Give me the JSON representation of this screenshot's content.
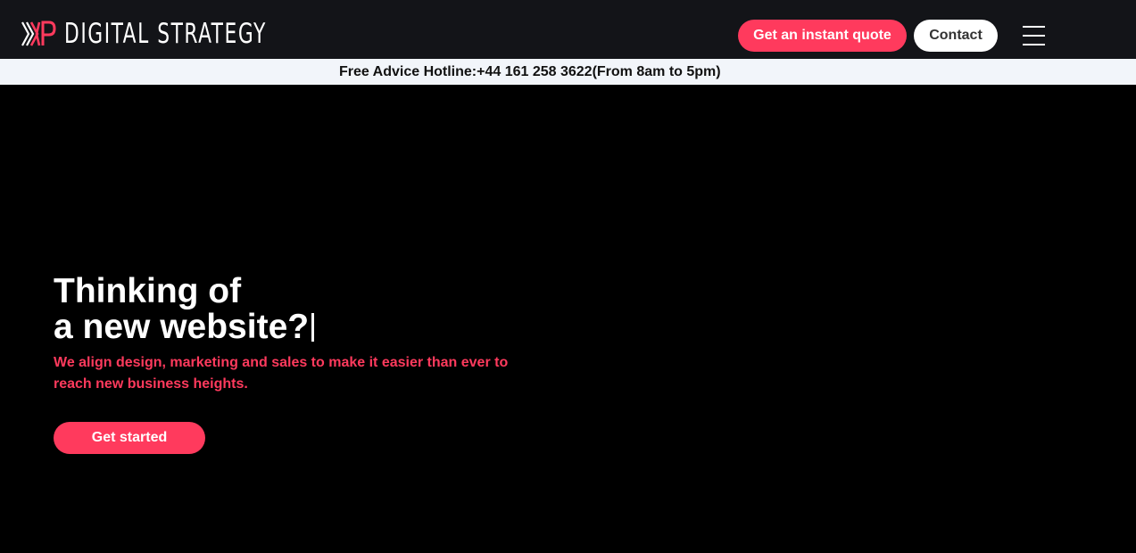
{
  "header": {
    "logo_text": "DIGITAL STRATEGY",
    "logo_mark_name": "kp-chevron-logo",
    "quote_button": "Get an instant quote",
    "contact_button": "Contact",
    "menu_icon": "hamburger-menu-icon"
  },
  "hotline": {
    "text": "Free Advice Hotline:+44 161 258 3622(From 8am to 5pm)"
  },
  "hero": {
    "headline_line1": "Thinking of",
    "headline_line2": "a new website?",
    "subtitle": "We align design, marketing and sales to make it easier than ever to reach new business heights.",
    "cta_button": "Get started"
  },
  "colors": {
    "accent": "#ff3a5d",
    "header_bg": "#131418",
    "hotline_bg": "#f2f5fa",
    "hero_bg": "#000000",
    "white": "#ffffff"
  }
}
